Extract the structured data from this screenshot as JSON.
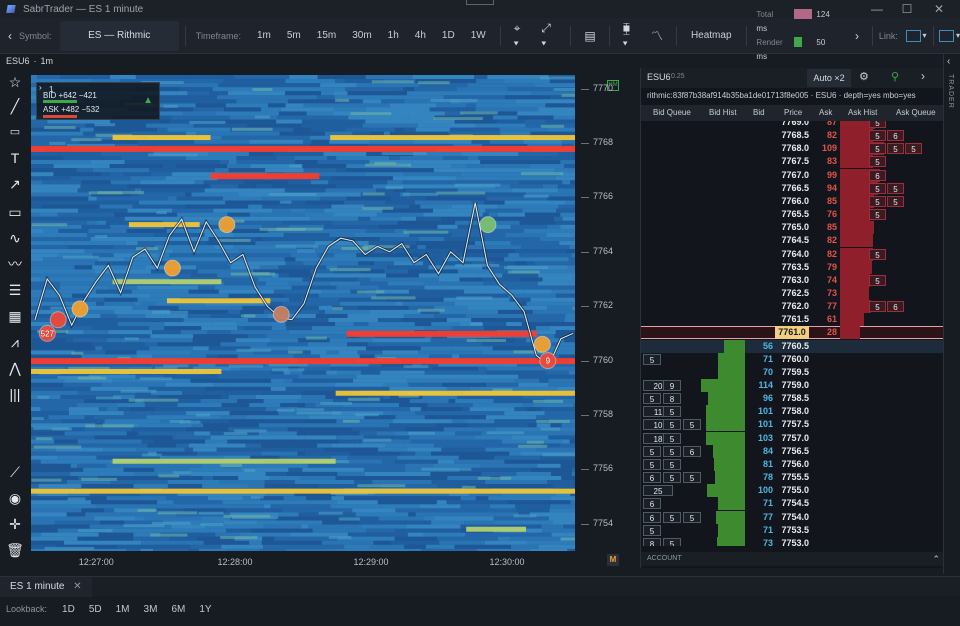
{
  "window": {
    "title": "SabrTrader — ES 1 minute",
    "minimize": "—",
    "maximize": "☐",
    "close": "✕"
  },
  "toolbar": {
    "back": "‹",
    "symbol_label": "Symbol:",
    "symbol_value": "ES — Rithmic",
    "timeframe_label": "Timeframe:",
    "timeframes": [
      "1m",
      "5m",
      "15m",
      "30m",
      "1h",
      "4h",
      "1D",
      "1W"
    ],
    "heatmap_label": "Heatmap",
    "total_label": "Total",
    "total_value": "124 ms",
    "render_label": "Render",
    "render_value": "50 ms",
    "total_color": "#b06a86",
    "render_color": "#3ea84a",
    "forward": "›",
    "link_label": "Link:"
  },
  "subbar": {
    "symbol": "ESU6",
    "interval": "1m"
  },
  "tooltip": {
    "count": "1",
    "bid": "BID +642 −421",
    "ask": "ASK +482 −532"
  },
  "chart_data": {
    "type": "heatmap",
    "title": "",
    "ylim": [
      7753,
      7770.5
    ],
    "y_ticks": [
      "7770",
      "7768",
      "7766",
      "7764",
      "7762",
      "7760",
      "7758",
      "7756",
      "7754"
    ],
    "x_ticks": [
      "12:27:00",
      "12:28:00",
      "12:29:00",
      "12:30:00"
    ],
    "liquidity_bands": [
      {
        "price": 7767.8,
        "from": 0.0,
        "to": 1.0,
        "level": "high"
      },
      {
        "price": 7768.2,
        "from": 0.15,
        "to": 0.33,
        "level": "mid"
      },
      {
        "price": 7768.2,
        "from": 0.55,
        "to": 1.0,
        "level": "mid"
      },
      {
        "price": 7766.8,
        "from": 0.33,
        "to": 0.53,
        "level": "high"
      },
      {
        "price": 7765.0,
        "from": 0.18,
        "to": 0.31,
        "level": "mid"
      },
      {
        "price": 7762.2,
        "from": 0.25,
        "to": 0.44,
        "level": "mid"
      },
      {
        "price": 7761.0,
        "from": 0.58,
        "to": 0.93,
        "level": "high"
      },
      {
        "price": 7760.0,
        "from": 0.0,
        "to": 1.0,
        "level": "high"
      },
      {
        "price": 7758.8,
        "from": 0.56,
        "to": 1.0,
        "level": "mid"
      },
      {
        "price": 7756.3,
        "from": 0.15,
        "to": 0.56,
        "level": "low"
      },
      {
        "price": 7755.2,
        "from": 0.0,
        "to": 1.0,
        "level": "mid"
      },
      {
        "price": 7753.8,
        "from": 0.8,
        "to": 0.91,
        "level": "low"
      },
      {
        "price": 7759.6,
        "from": 0.0,
        "to": 0.35,
        "level": "mid"
      },
      {
        "price": 7762.9,
        "from": 0.15,
        "to": 0.35,
        "level": "low"
      }
    ],
    "price_path": [
      7761.5,
      7763.0,
      7762.4,
      7761.3,
      7762.2,
      7762.9,
      7763.5,
      7762.5,
      7763.8,
      7764.1,
      7763.4,
      7764.6,
      7765.2,
      7764.0,
      7765.1,
      7764.4,
      7763.6,
      7763.9,
      7762.7,
      7762.0,
      7761.6,
      7761.5,
      7762.1,
      7763.4,
      7764.2,
      7764.5,
      7764.4,
      7763.9,
      7764.2,
      7764.0,
      7764.3,
      7763.6,
      7763.9,
      7763.2,
      7764.0,
      7763.6,
      7765.8,
      7763.5,
      7762.8,
      7762.4,
      7761.8,
      7760.2,
      7759.8,
      7760.8,
      7761.0
    ],
    "trades": [
      {
        "t": 0.03,
        "price": 7761.0,
        "size": "527",
        "color": "#e94b3c"
      },
      {
        "t": 0.05,
        "price": 7761.5,
        "size": "",
        "color": "#e94b3c"
      },
      {
        "t": 0.09,
        "price": 7761.9,
        "size": "",
        "color": "#f0a030"
      },
      {
        "t": 0.26,
        "price": 7763.4,
        "size": "",
        "color": "#f0a030"
      },
      {
        "t": 0.36,
        "price": 7765.0,
        "size": "",
        "color": "#f0a030"
      },
      {
        "t": 0.46,
        "price": 7761.7,
        "size": "",
        "color": "#c88060"
      },
      {
        "t": 0.84,
        "price": 7765.0,
        "size": "",
        "color": "#7bc070"
      },
      {
        "t": 0.95,
        "price": 7760.0,
        "size": "9",
        "color": "#e94b3c"
      },
      {
        "t": 0.94,
        "price": 7760.6,
        "size": "",
        "color": "#f0a030"
      }
    ]
  },
  "bottom": {
    "tab_label": "ES 1 minute",
    "tab_close": "✕",
    "lookback_label": "Lookback:",
    "lookback_options": [
      "1D",
      "5D",
      "1M",
      "3M",
      "6M",
      "1Y"
    ],
    "badge_m": "M",
    "badge_hm": "HM"
  },
  "dom": {
    "symbol": "ESU6",
    "tick": "0.25",
    "mode": "Auto ×2",
    "info": "rithmic:83f87b38af914b35ba1de01713f8e005 · ESU6 · depth=yes mbo=yes ticks=yes",
    "columns": [
      "Bid Queue",
      "Bid Hist",
      "Bid",
      "Price",
      "Ask",
      "Ask Hist",
      "Ask Queue"
    ],
    "footer": "ACCOUNT",
    "trader_tab": "TRADER",
    "ask_rows": [
      {
        "price": "7769.0",
        "ask": "87",
        "queue": [
          "5"
        ]
      },
      {
        "price": "7768.5",
        "ask": "82",
        "queue": [
          "5",
          "6"
        ]
      },
      {
        "price": "7768.0",
        "ask": "109",
        "queue": [
          "5",
          "5",
          "5"
        ]
      },
      {
        "price": "7767.5",
        "ask": "83",
        "queue": [
          "5"
        ]
      },
      {
        "price": "7767.0",
        "ask": "99",
        "queue": [
          "6"
        ]
      },
      {
        "price": "7766.5",
        "ask": "94",
        "queue": [
          "5",
          "5"
        ]
      },
      {
        "price": "7766.0",
        "ask": "85",
        "queue": [
          "5",
          "5"
        ]
      },
      {
        "price": "7765.5",
        "ask": "76",
        "queue": [
          "5"
        ]
      },
      {
        "price": "7765.0",
        "ask": "85",
        "queue": []
      },
      {
        "price": "7764.5",
        "ask": "82",
        "queue": []
      },
      {
        "price": "7764.0",
        "ask": "82",
        "queue": [
          "5"
        ]
      },
      {
        "price": "7763.5",
        "ask": "79",
        "queue": []
      },
      {
        "price": "7763.0",
        "ask": "74",
        "queue": [
          "5"
        ]
      },
      {
        "price": "7762.5",
        "ask": "73",
        "queue": []
      },
      {
        "price": "7762.0",
        "ask": "77",
        "queue": [
          "5",
          "6"
        ]
      },
      {
        "price": "7761.5",
        "ask": "61",
        "queue": []
      }
    ],
    "last_row": {
      "price": "7761.0",
      "ask": "28"
    },
    "bid_rows": [
      {
        "price": "7760.5",
        "bid": "56",
        "queue": []
      },
      {
        "price": "7760.0",
        "bid": "71",
        "queue": [
          "5"
        ]
      },
      {
        "price": "7759.5",
        "bid": "70",
        "queue": []
      },
      {
        "price": "7759.0",
        "bid": "114",
        "queue": [
          "20",
          "9"
        ]
      },
      {
        "price": "7758.5",
        "bid": "96",
        "queue": [
          "5",
          "8"
        ]
      },
      {
        "price": "7758.0",
        "bid": "101",
        "queue": [
          "11",
          "5"
        ]
      },
      {
        "price": "7757.5",
        "bid": "101",
        "queue": [
          "10",
          "5",
          "5"
        ]
      },
      {
        "price": "7757.0",
        "bid": "103",
        "queue": [
          "18",
          "5"
        ]
      },
      {
        "price": "7756.5",
        "bid": "84",
        "queue": [
          "5",
          "5",
          "6"
        ]
      },
      {
        "price": "7756.0",
        "bid": "81",
        "queue": [
          "5",
          "5"
        ]
      },
      {
        "price": "7755.5",
        "bid": "78",
        "queue": [
          "6",
          "5",
          "5"
        ]
      },
      {
        "price": "7755.0",
        "bid": "100",
        "queue": [
          "25"
        ]
      },
      {
        "price": "7754.5",
        "bid": "71",
        "queue": [
          "6"
        ]
      },
      {
        "price": "7754.0",
        "bid": "77",
        "queue": [
          "6",
          "5",
          "5"
        ]
      },
      {
        "price": "7753.5",
        "bid": "71",
        "queue": [
          "5"
        ]
      },
      {
        "price": "7753.0",
        "bid": "73",
        "queue": [
          "8",
          "5"
        ]
      }
    ]
  }
}
